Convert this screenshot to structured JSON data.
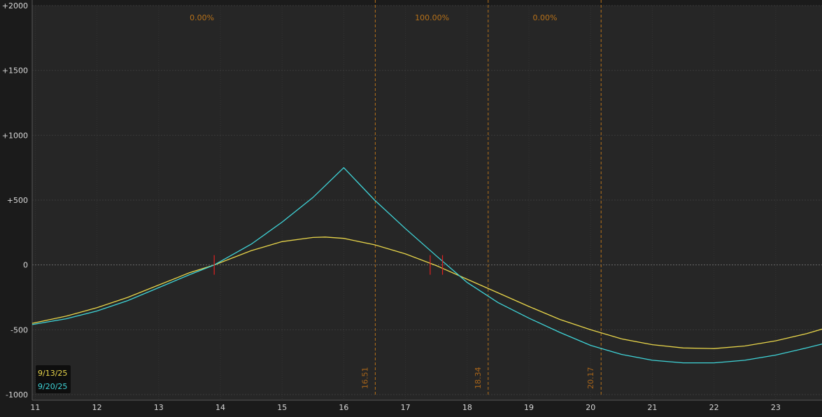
{
  "chart_data": {
    "type": "line",
    "xlim": [
      10.95,
      23.75
    ],
    "ylim": [
      -1000,
      2000
    ],
    "x_ticks": [
      11,
      12,
      13,
      14,
      15,
      16,
      17,
      18,
      19,
      20,
      21,
      22,
      23
    ],
    "x_tick_labels": [
      "11",
      "12",
      "13",
      "14",
      "15",
      "16",
      "17",
      "18",
      "19",
      "20",
      "21",
      "22",
      "23"
    ],
    "y_ticks": [
      2000,
      1500,
      1000,
      500,
      0,
      -500,
      -1000
    ],
    "y_tick_labels": [
      "+2000",
      "+1500",
      "+1000",
      "+500",
      "0",
      "-500",
      "-1000"
    ],
    "grid": "dark dotted",
    "zero_line": true,
    "series": [
      {
        "name": "9/13/25",
        "color": "#e8d54a",
        "x": [
          10.95,
          11.5,
          12.0,
          12.5,
          13.0,
          13.5,
          13.9,
          14.5,
          15.0,
          15.5,
          15.7,
          16.0,
          16.5,
          17.0,
          17.5,
          18.0,
          18.5,
          19.0,
          19.5,
          20.0,
          20.5,
          21.0,
          21.5,
          22.0,
          22.5,
          23.0,
          23.5,
          23.75
        ],
        "y": [
          -450,
          -395,
          -330,
          -250,
          -155,
          -60,
          0,
          110,
          180,
          212,
          215,
          205,
          155,
          85,
          -5,
          -110,
          -215,
          -320,
          -420,
          -500,
          -570,
          -615,
          -640,
          -645,
          -625,
          -585,
          -530,
          -495
        ]
      },
      {
        "name": "9/20/25",
        "color": "#3fd4d8",
        "x": [
          10.95,
          11.5,
          12.0,
          12.5,
          13.0,
          13.5,
          13.9,
          14.5,
          15.0,
          15.5,
          16.0,
          16.5,
          17.0,
          17.5,
          18.0,
          18.5,
          19.0,
          19.5,
          20.0,
          20.5,
          21.0,
          21.5,
          22.0,
          22.5,
          23.0,
          23.5,
          23.75
        ],
        "y": [
          -460,
          -415,
          -355,
          -275,
          -175,
          -75,
          0,
          160,
          330,
          520,
          750,
          500,
          280,
          70,
          -135,
          -290,
          -410,
          -520,
          -620,
          -690,
          -735,
          -755,
          -755,
          -735,
          -695,
          -640,
          -610
        ]
      }
    ],
    "breakeven_markers": [
      13.9,
      17.4,
      17.6
    ],
    "vertical_lines": [
      {
        "x": 16.51,
        "label": "16.51"
      },
      {
        "x": 18.34,
        "label": "18.34"
      },
      {
        "x": 20.17,
        "label": "20.17"
      }
    ],
    "percent_labels": [
      {
        "x": 13.7,
        "label": "0.00%"
      },
      {
        "x": 17.43,
        "label": "100.00%"
      },
      {
        "x": 19.26,
        "label": "0.00%"
      }
    ],
    "legend": {
      "placement": "bottom-left",
      "entries": [
        {
          "label": "9/13/25",
          "color": "#e8d54a"
        },
        {
          "label": "9/20/25",
          "color": "#3fd4d8"
        }
      ]
    }
  }
}
